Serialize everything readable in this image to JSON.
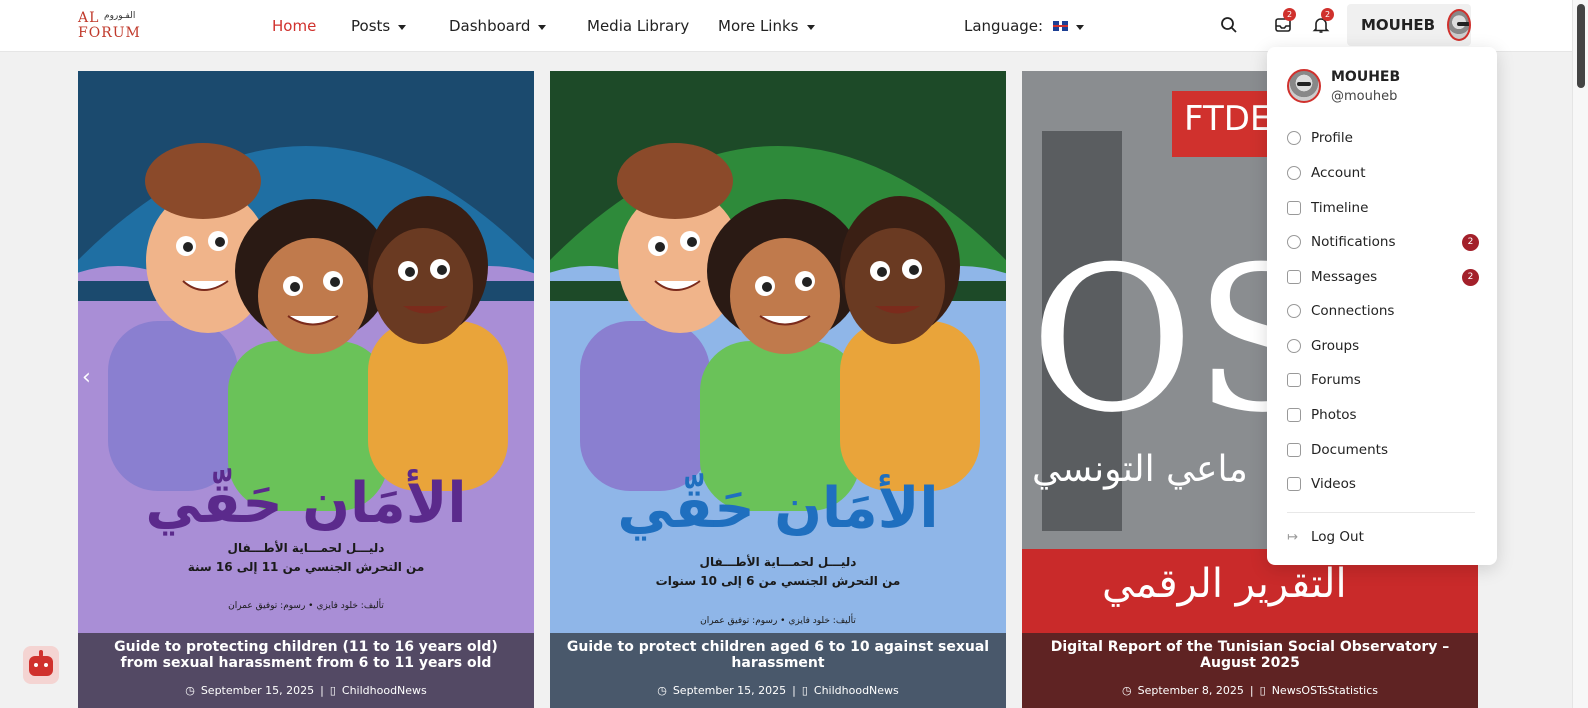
{
  "logo": {
    "latin_top": "AL",
    "latin_bottom": "FORUM",
    "arabic": "الفـوروم"
  },
  "nav": {
    "items": [
      {
        "label": "Home",
        "active": true,
        "has_caret": false
      },
      {
        "label": "Posts",
        "active": false,
        "has_caret": true
      },
      {
        "label": "Dashboard",
        "active": false,
        "has_caret": true
      },
      {
        "label": "Media Library",
        "active": false,
        "has_caret": false
      },
      {
        "label": "More Links",
        "active": false,
        "has_caret": true
      }
    ],
    "language_label": "Language:"
  },
  "header_icons": {
    "search": "search-icon",
    "messages": {
      "icon": "inbox-icon",
      "count": "2"
    },
    "notifications": {
      "icon": "bell-icon",
      "count": "2"
    }
  },
  "user": {
    "name": "MOUHEB",
    "handle": "@mouheb"
  },
  "user_menu": {
    "items": [
      {
        "label": "Profile",
        "icon": "profile-icon"
      },
      {
        "label": "Account",
        "icon": "account-icon"
      },
      {
        "label": "Timeline",
        "icon": "timeline-icon"
      },
      {
        "label": "Notifications",
        "icon": "bell-icon",
        "count": "2"
      },
      {
        "label": "Messages",
        "icon": "inbox-icon",
        "count": "2"
      },
      {
        "label": "Connections",
        "icon": "connections-icon"
      },
      {
        "label": "Groups",
        "icon": "groups-icon"
      },
      {
        "label": "Forums",
        "icon": "forums-icon"
      },
      {
        "label": "Photos",
        "icon": "photos-icon"
      },
      {
        "label": "Documents",
        "icon": "folder-icon"
      },
      {
        "label": "Videos",
        "icon": "video-icon"
      }
    ],
    "logout": "Log Out"
  },
  "cards": [
    {
      "title": "Guide to protecting children (11 to 16 years old) from sexual harassment from 6 to 11 years old",
      "date": "September 15, 2025",
      "category": "ChildhoodNews",
      "cover_title": "الأمَان حَقّي",
      "cover_sub1": "دليـــل لحمـــاية الأطـــفال",
      "cover_sub2": "من التحرش الجنسي من 11 إلى 16 سنة",
      "cover_credit": "تأليف: خلود فايزي • رسوم: توفيق عمران",
      "colors": {
        "bg": "#a98ed6",
        "title": "#5b2a8c",
        "umbrella": "#1f6fa3"
      }
    },
    {
      "title": "Guide to protect children aged 6 to 10 against sexual harassment",
      "date": "September 15, 2025",
      "category": "ChildhoodNews",
      "cover_title": "الأمَان حَقّي",
      "cover_sub1": "دليـــل لحمـــاية الأطـــفال",
      "cover_sub2": "من التحرش الجنسي من 6 إلى 10 سنوات",
      "cover_credit": "تأليف: خلود فايزي • رسوم: توفيق عمران",
      "colors": {
        "bg": "#8fb6e8",
        "title": "#1f6fbf",
        "umbrella": "#2e8a3a"
      }
    },
    {
      "title": "Digital Report of the Tunisian Social Observatory – August 2025",
      "date": "September 8, 2025",
      "category": "NewsOSTsStatistics",
      "cover_brand": "FTDES",
      "cover_big": "OS",
      "cover_arabic": "ماعي التونسي",
      "cover_bottom": "التقرير الرقمي",
      "colors": {
        "bg": "#6f7376",
        "accent": "#d0312d"
      }
    }
  ]
}
